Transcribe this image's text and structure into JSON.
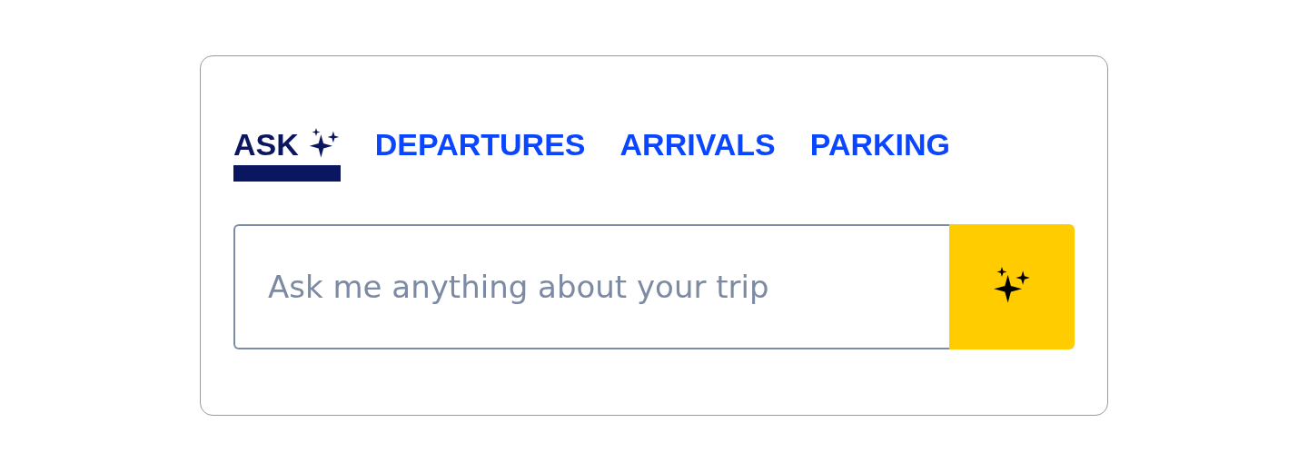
{
  "tabs": [
    {
      "label": "ASK",
      "kind": "ai",
      "selected": true
    },
    {
      "label": "DEPARTURES",
      "kind": "plain",
      "selected": false
    },
    {
      "label": "ARRIVALS",
      "kind": "plain",
      "selected": false
    },
    {
      "label": "PARKING",
      "kind": "plain",
      "selected": false
    }
  ],
  "search": {
    "placeholder": "Ask me anything about your trip"
  }
}
